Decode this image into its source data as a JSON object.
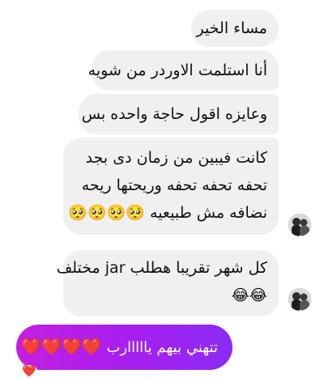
{
  "messages": {
    "m1": "مساء الخير",
    "m2": "أنا استلمت الاوردر من شويه",
    "m3": "وعايزه اقول حاجة واحده بس",
    "m4": {
      "line1": "كانت فيبين من زمان دى بجد",
      "line2": "تحفه تحفه تحفه وريحتها ريحه",
      "line3": "نضافه مش طبيعيه",
      "emoji": "🥺🥺🥺🥺"
    },
    "m5": {
      "line1": "كل شهر تقريبا هطلب jar مختلف",
      "emoji": "😂😂"
    },
    "sent": {
      "text": "تتهني بيهم يااااارب",
      "hearts": "❤️❤️❤️❤️"
    },
    "reaction": "❤️"
  },
  "avatar": {
    "icon": "profile-photo"
  },
  "colors": {
    "incoming_bubble": "#f0f0f0",
    "outgoing_gradient_start": "#c41fe0",
    "outgoing_gradient_end": "#8a2cf3",
    "heart": "#e8192c"
  }
}
